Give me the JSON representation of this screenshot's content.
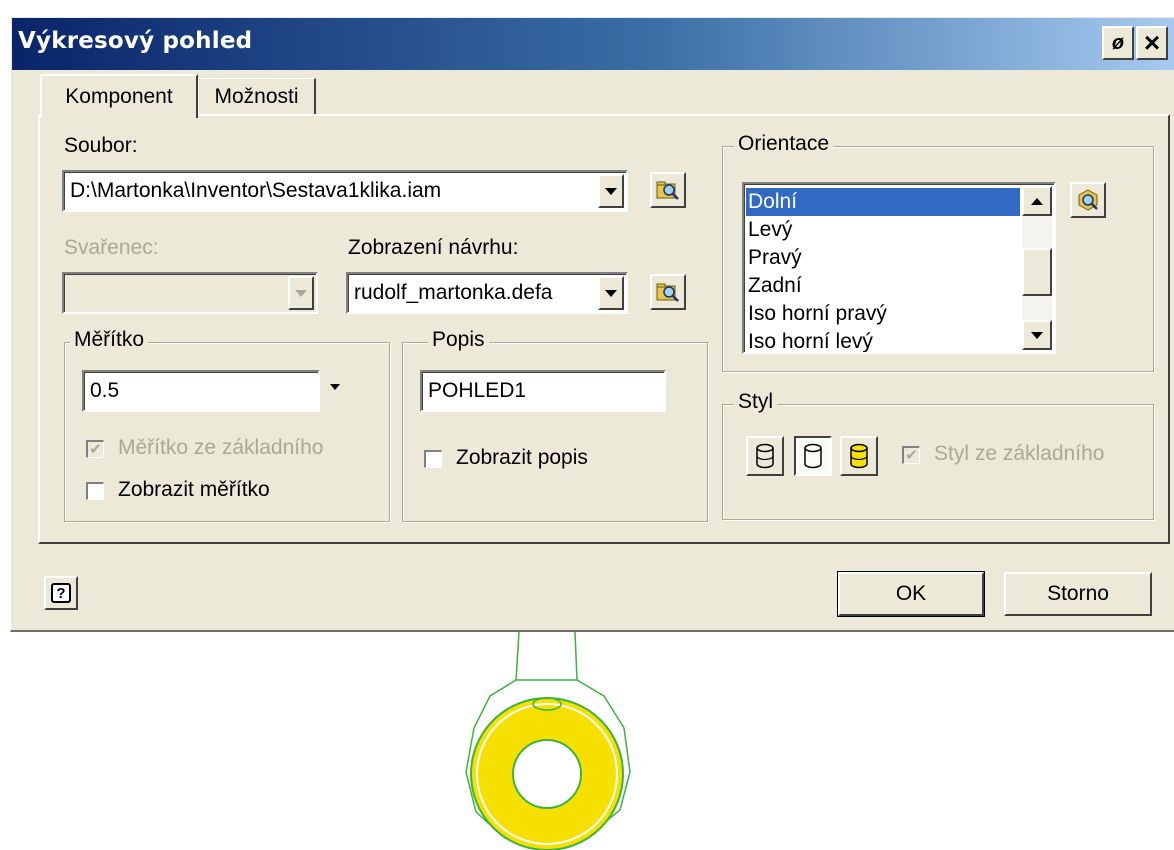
{
  "dialog": {
    "title": "Výkresový pohled",
    "pin_label": "ø",
    "close_label": "×"
  },
  "tabs": [
    {
      "label": "Komponent",
      "active": true
    },
    {
      "label": "Možnosti",
      "active": false
    }
  ],
  "file": {
    "label": "Soubor:",
    "value": "D:\\Martonka\\Inventor\\Sestava1klika.iam"
  },
  "weldment": {
    "label": "Svařenec:",
    "value": ""
  },
  "design_view": {
    "label": "Zobrazení návrhu:",
    "value": "rudolf_martonka.defa"
  },
  "scale": {
    "legend": "Měřítko",
    "value": "0.5",
    "from_base_label": "Měřítko ze základního",
    "from_base_checked": true,
    "show_label": "Zobrazit měřítko",
    "show_checked": false
  },
  "label_group": {
    "legend": "Popis",
    "value": "POHLED1",
    "show_label": "Zobrazit popis",
    "show_checked": false
  },
  "orientation": {
    "legend": "Orientace",
    "items": [
      "Dolní",
      "Levý",
      "Pravý",
      "Zadní",
      "Iso horní pravý",
      "Iso horní levý"
    ],
    "selected": "Dolní"
  },
  "style": {
    "legend": "Styl",
    "from_base_label": "Styl ze základního",
    "from_base_checked": true,
    "shaded_color": "#f5e000"
  },
  "buttons": {
    "ok": "OK",
    "cancel": "Storno",
    "help_label": "?"
  },
  "colors": {
    "titlebar_start": "#0a246a",
    "selection": "#316ac5",
    "sketch_line": "#3cb43c",
    "part_fill": "#f5e000"
  }
}
